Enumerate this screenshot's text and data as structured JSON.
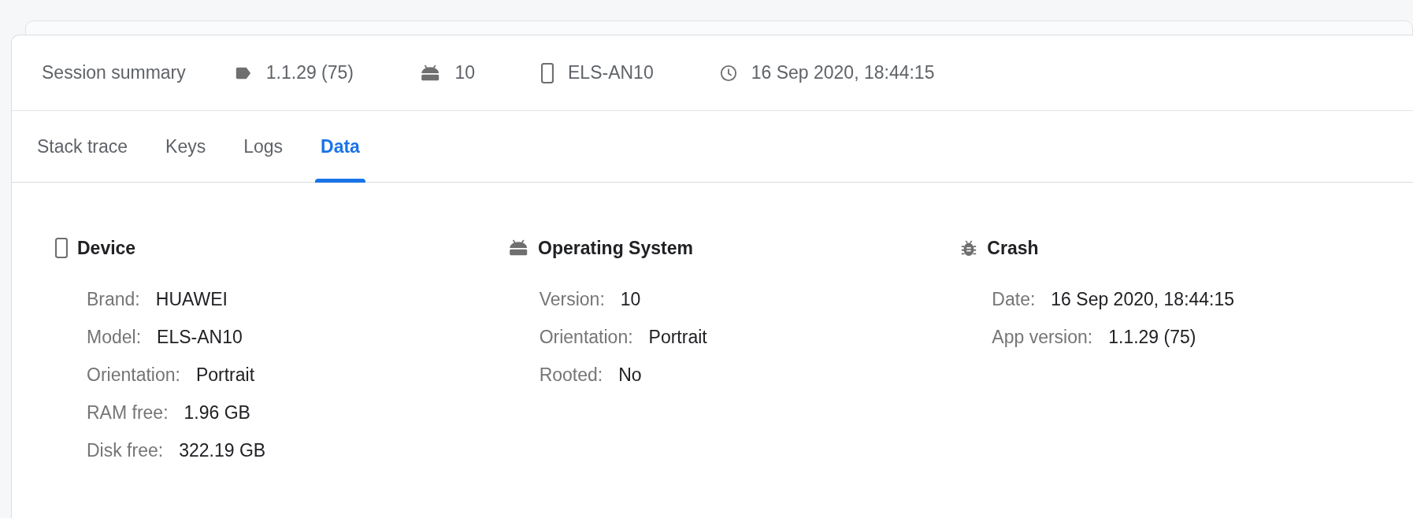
{
  "summary": {
    "title": "Session summary",
    "items": [
      {
        "kind": "version",
        "text": "1.1.29 (75)"
      },
      {
        "kind": "os",
        "text": "10"
      },
      {
        "kind": "device",
        "text": "ELS-AN10"
      },
      {
        "kind": "time",
        "text": "16 Sep 2020, 18:44:15"
      }
    ]
  },
  "tabs": [
    {
      "label": "Stack trace",
      "selected": false
    },
    {
      "label": "Keys",
      "selected": false
    },
    {
      "label": "Logs",
      "selected": false
    },
    {
      "label": "Data",
      "selected": true
    }
  ],
  "sections": [
    {
      "kind": "device",
      "title": "Device",
      "rows": [
        {
          "label": "Brand:",
          "value": "HUAWEI"
        },
        {
          "label": "Model:",
          "value": "ELS-AN10"
        },
        {
          "label": "Orientation:",
          "value": "Portrait"
        },
        {
          "label": "RAM free:",
          "value": "1.96 GB"
        },
        {
          "label": "Disk free:",
          "value": "322.19 GB"
        }
      ]
    },
    {
      "kind": "os",
      "title": "Operating System",
      "rows": [
        {
          "label": "Version:",
          "value": "10"
        },
        {
          "label": "Orientation:",
          "value": "Portrait"
        },
        {
          "label": "Rooted:",
          "value": "No"
        }
      ]
    },
    {
      "kind": "crash",
      "title": "Crash",
      "rows": [
        {
          "label": "Date:",
          "value": "16 Sep 2020, 18:44:15"
        },
        {
          "label": "App version:",
          "value": "1.1.29 (75)"
        }
      ]
    }
  ]
}
